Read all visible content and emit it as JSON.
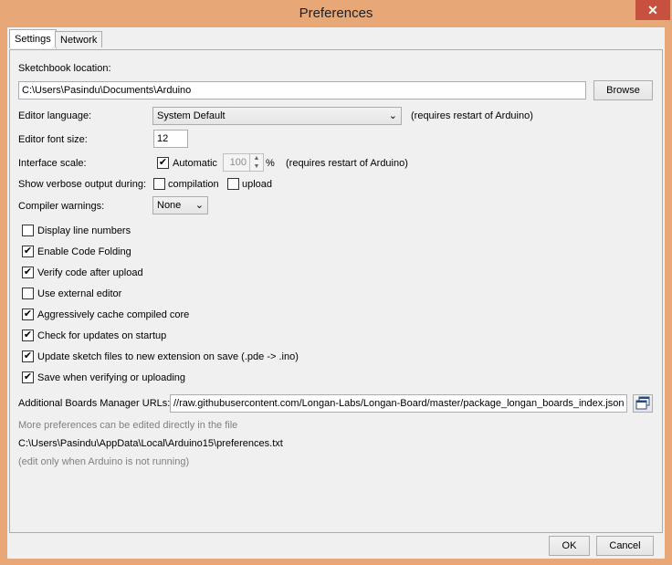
{
  "window": {
    "title": "Preferences",
    "close_label": "✕"
  },
  "tabs": [
    {
      "label": "Settings",
      "active": true
    },
    {
      "label": "Network",
      "active": false
    }
  ],
  "settings": {
    "sketchbook_label": "Sketchbook location:",
    "sketchbook_value": "C:\\Users\\Pasindu\\Documents\\Arduino",
    "browse_label": "Browse",
    "editor_language_label": "Editor language:",
    "editor_language_value": "System Default",
    "editor_language_note": "(requires restart of Arduino)",
    "font_size_label": "Editor font size:",
    "font_size_value": "12",
    "interface_scale_label": "Interface scale:",
    "automatic_label": "Automatic",
    "scale_value": "100",
    "percent_label": "%",
    "scale_note": "(requires restart of Arduino)",
    "verbose_label": "Show verbose output during:",
    "compilation_label": "compilation",
    "upload_label": "upload",
    "compiler_warnings_label": "Compiler warnings:",
    "compiler_warnings_value": "None",
    "options": [
      {
        "label": "Display line numbers",
        "checked": false
      },
      {
        "label": "Enable Code Folding",
        "checked": true
      },
      {
        "label": "Verify code after upload",
        "checked": true
      },
      {
        "label": "Use external editor",
        "checked": false
      },
      {
        "label": "Aggressively cache compiled core",
        "checked": true
      },
      {
        "label": "Check for updates on startup",
        "checked": true
      },
      {
        "label": "Update sketch files to new extension on save (.pde -> .ino)",
        "checked": true
      },
      {
        "label": "Save when verifying or uploading",
        "checked": true
      }
    ],
    "boards_urls_label": "Additional Boards Manager URLs:",
    "boards_urls_value": "//raw.githubusercontent.com/Longan-Labs/Longan-Board/master/package_longan_boards_index.json",
    "more_prefs_note": "More preferences can be edited directly in the file",
    "prefs_path": "C:\\Users\\Pasindu\\AppData\\Local\\Arduino15\\preferences.txt",
    "edit_note": "(edit only when Arduino is not running)"
  },
  "footer": {
    "ok_label": "OK",
    "cancel_label": "Cancel"
  }
}
